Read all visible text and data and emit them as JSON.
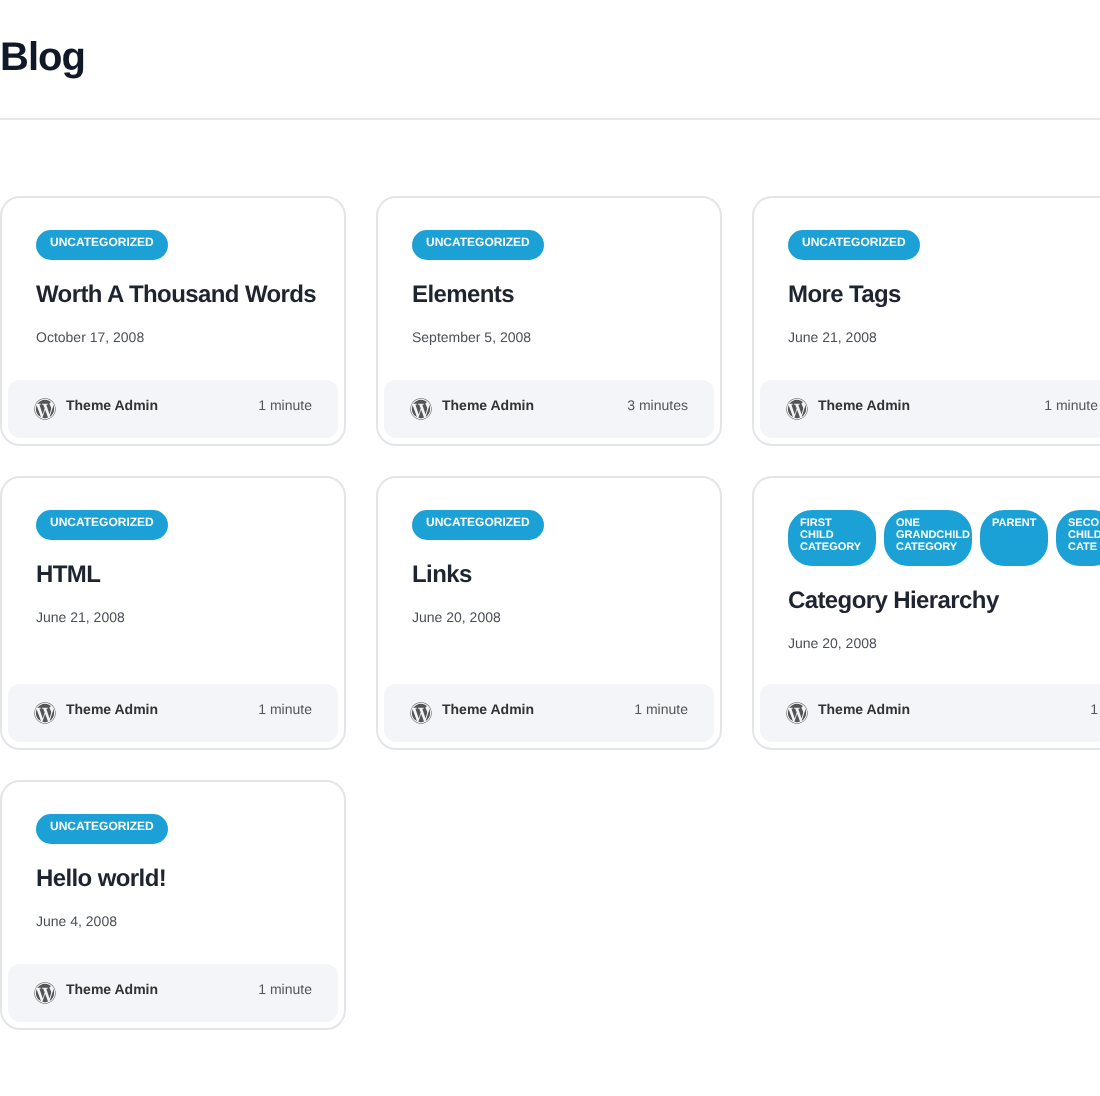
{
  "page_title": "Blog",
  "posts": [
    {
      "tags": [
        "UNCATEGORIZED"
      ],
      "title": "Worth A Thousand Words",
      "date": "October 17, 2008",
      "author": "Theme Admin",
      "read_time": "1 minute"
    },
    {
      "tags": [
        "UNCATEGORIZED"
      ],
      "title": "Elements",
      "date": "September 5, 2008",
      "author": "Theme Admin",
      "read_time": "3 minutes"
    },
    {
      "tags": [
        "UNCATEGORIZED"
      ],
      "title": "More Tags",
      "date": "June 21, 2008",
      "author": "Theme Admin",
      "read_time": "1 minute"
    },
    {
      "tags": [
        "UNCATEGORIZED"
      ],
      "title": "HTML",
      "date": "June 21, 2008",
      "author": "Theme Admin",
      "read_time": "1 minute"
    },
    {
      "tags": [
        "UNCATEGORIZED"
      ],
      "title": "Links",
      "date": "June 20, 2008",
      "author": "Theme Admin",
      "read_time": "1 minute"
    },
    {
      "tags": [
        "FIRST CHILD CATEGORY",
        "ONE GRANDCHILD CATEGORY",
        "PARENT",
        "SECO CHILD CATE"
      ],
      "title": "Category Hierarchy",
      "date": "June 20, 2008",
      "author": "Theme Admin",
      "read_time": "1"
    },
    {
      "tags": [
        "UNCATEGORIZED"
      ],
      "title": "Hello world!",
      "date": "June 4, 2008",
      "author": "Theme Admin",
      "read_time": "1 minute"
    }
  ]
}
